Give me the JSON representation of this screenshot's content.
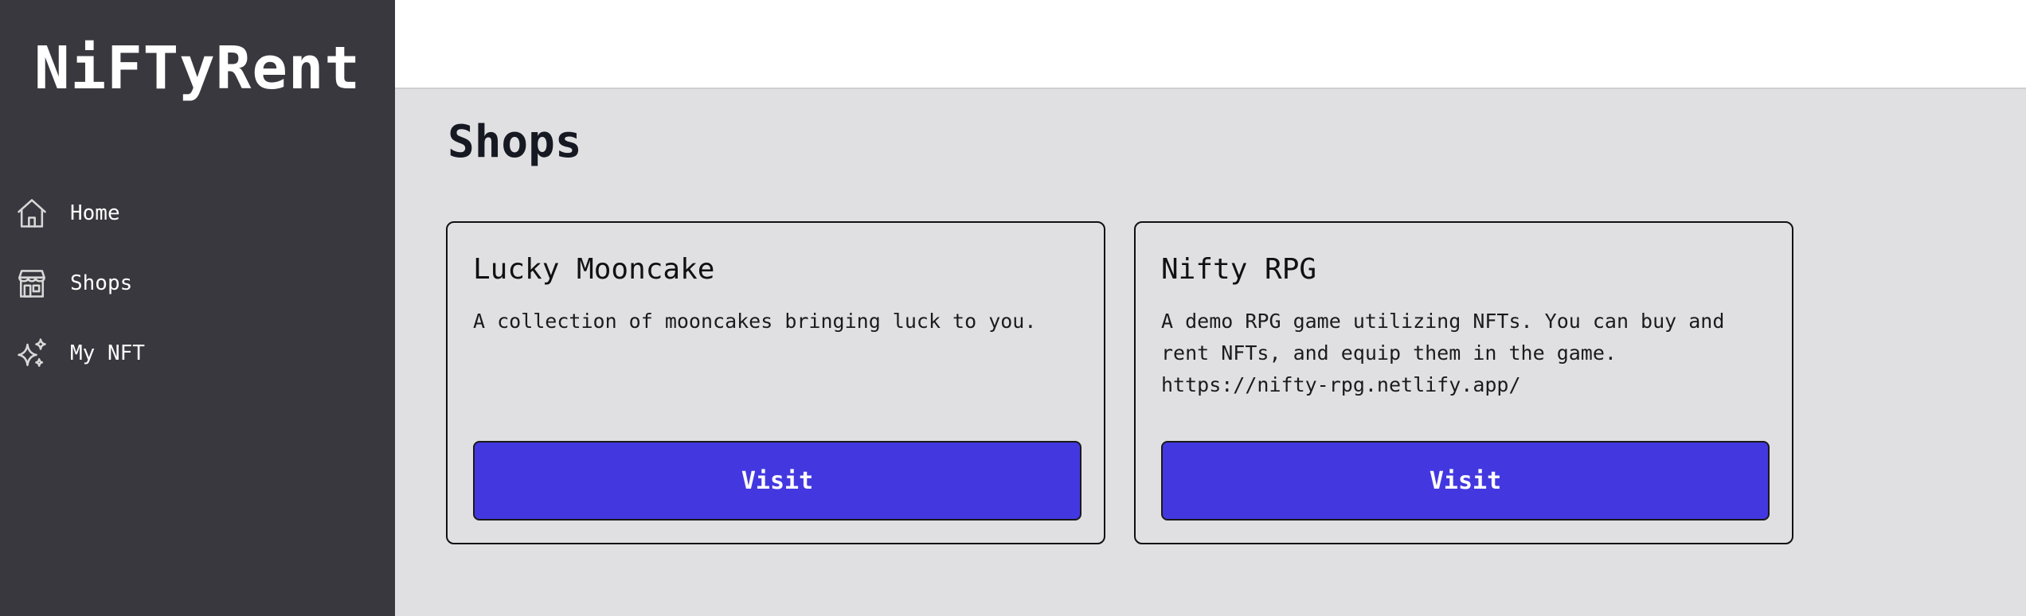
{
  "app": {
    "brand": "NiFTyRent"
  },
  "sidebar": {
    "items": [
      {
        "label": "Home",
        "icon": "home-icon"
      },
      {
        "label": "Shops",
        "icon": "storefront-icon"
      },
      {
        "label": "My NFT",
        "icon": "sparkles-icon"
      }
    ]
  },
  "main": {
    "title": "Shops",
    "shops": [
      {
        "name": "Lucky Mooncake",
        "description": "A collection of mooncakes bringing luck to you.",
        "button": "Visit"
      },
      {
        "name": "Nifty RPG",
        "description": "A demo RPG game utilizing NFTs. You can buy and\nrent NFTs, and equip them in the game.\nhttps://nifty-rpg.netlify.app/",
        "button": "Visit"
      }
    ]
  },
  "colors": {
    "sidebar_bg": "#38383e",
    "content_bg": "#e0e0e3",
    "accent": "#4338e0"
  }
}
